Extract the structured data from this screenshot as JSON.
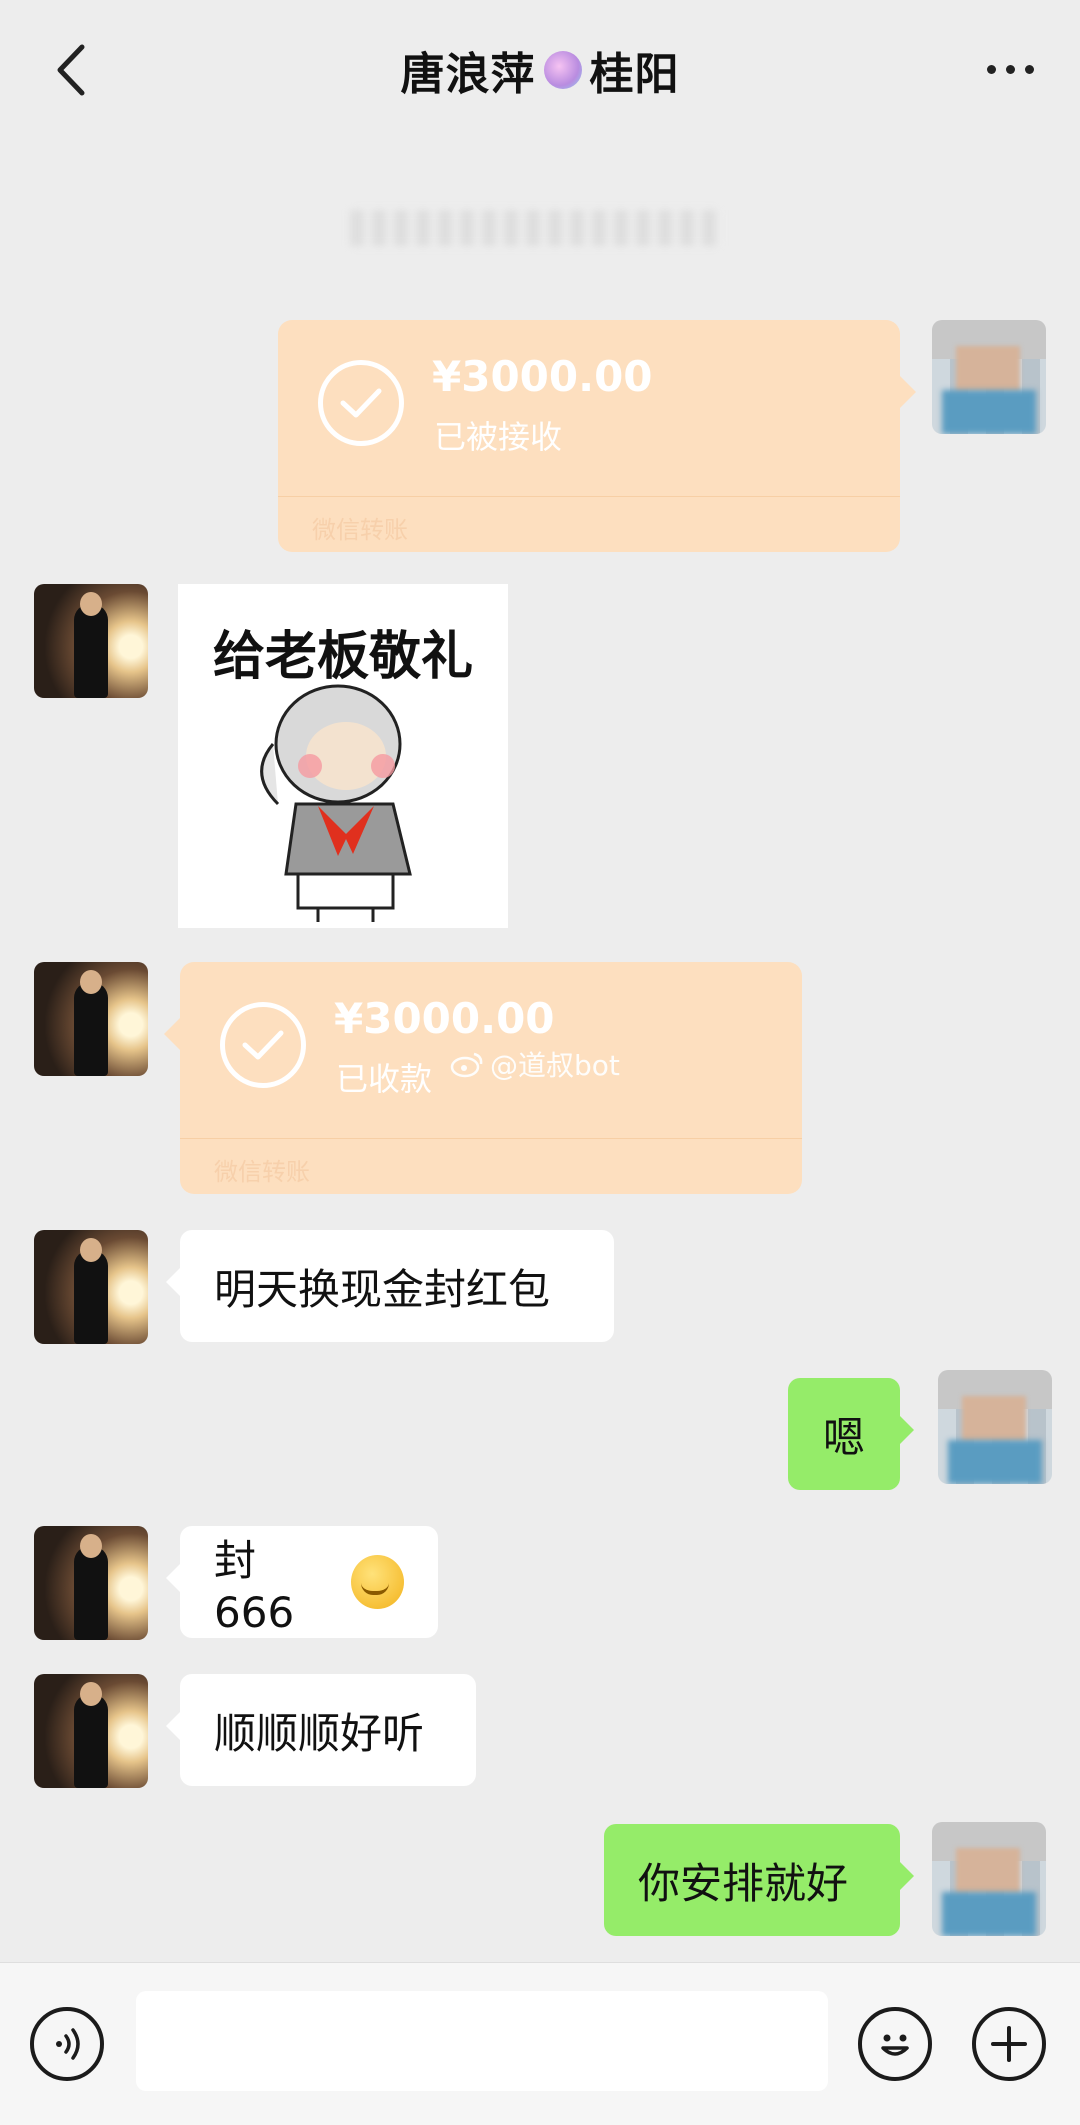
{
  "header": {
    "title_name": "唐浪萍",
    "title_city": "桂阳"
  },
  "icons": {
    "back": "chevron-left-icon",
    "more": "more-dots-icon",
    "voice": "voice-icon",
    "emoji": "emoji-icon",
    "plus": "plus-icon"
  },
  "colors": {
    "background": "#ededed",
    "outgoing_bubble": "#95ec69",
    "incoming_bubble": "#ffffff",
    "transfer_card": "#fddfbf"
  },
  "messages": {
    "transfer1": {
      "amount": "¥3000.00",
      "status": "已被接收",
      "footer": "微信转账"
    },
    "sticker": {
      "caption": "给老板敬礼"
    },
    "transfer2": {
      "amount": "¥3000.00",
      "status": "已收款",
      "footer": "微信转账"
    },
    "text1": "明天换现金封红包",
    "text2": "嗯",
    "text3": "封 666",
    "text4": "顺顺顺好听",
    "text5": "你安排就好"
  },
  "watermark": "@道叔bot"
}
